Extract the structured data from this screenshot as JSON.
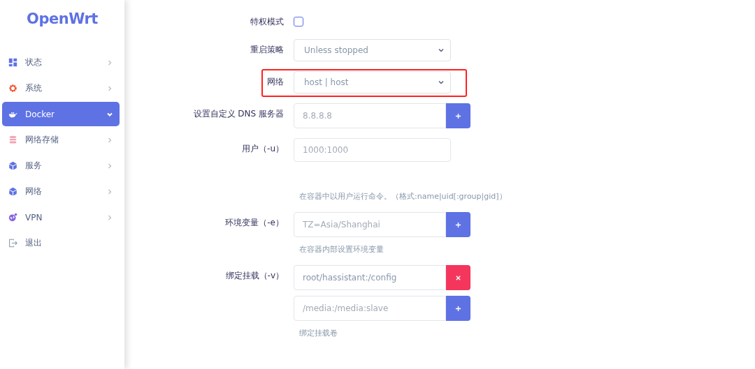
{
  "sidebar": {
    "logo": "OpenWrt",
    "items": [
      {
        "label": "状态",
        "kind": "grid",
        "selected": false,
        "expanded": false
      },
      {
        "label": "系统",
        "kind": "gear",
        "selected": false,
        "expanded": false
      },
      {
        "label": "Docker",
        "kind": "whale",
        "selected": true,
        "expanded": true
      },
      {
        "label": "网络存储",
        "kind": "database",
        "selected": false,
        "expanded": false
      },
      {
        "label": "服务",
        "kind": "cube",
        "selected": false,
        "expanded": false
      },
      {
        "label": "网络",
        "kind": "cube",
        "selected": false,
        "expanded": false
      },
      {
        "label": "VPN",
        "kind": "globe",
        "selected": false,
        "expanded": false
      },
      {
        "label": "退出",
        "kind": "logout",
        "selected": false
      }
    ]
  },
  "fields": [
    {
      "kind": "checkbox",
      "label": "特权模式",
      "checked": false
    },
    {
      "kind": "select",
      "label": "重启策略",
      "value": "Unless stopped"
    },
    {
      "kind": "select",
      "label": "网络",
      "value": "host | host",
      "highlighted": true
    },
    {
      "kind": "list",
      "label": "设置自定义 DNS 服务器",
      "entries": [
        {
          "placeholder": "8.8.8.8",
          "kind": "add"
        }
      ]
    },
    {
      "kind": "input",
      "label": "用户（-u）",
      "placeholder": "1000:1000",
      "help": "在容器中以用户运行命令。（格式:name|uid[:group|gid]）"
    },
    {
      "kind": "list",
      "label": "环境变量（-e）",
      "entries": [
        {
          "placeholder": "TZ=Asia/Shanghai",
          "kind": "add"
        }
      ],
      "help": "在容器内部设置环境变量"
    },
    {
      "kind": "list",
      "label": "绑定挂载（-v）",
      "entries": [
        {
          "value": "root/hassistant:/config",
          "kind": "remove"
        },
        {
          "placeholder": "/media:/media:slave",
          "kind": "add"
        }
      ],
      "help": "绑定挂载卷"
    }
  ]
}
